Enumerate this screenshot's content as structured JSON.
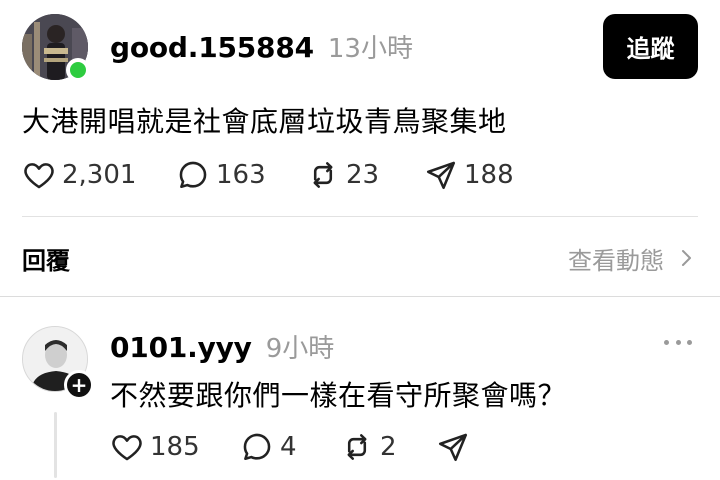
{
  "post": {
    "username": "good.155884",
    "time": "13小時",
    "follow_label": "追蹤",
    "text": "大港開唱就是社會底層垃圾青鳥聚集地",
    "likes": "2,301",
    "comments": "163",
    "reposts": "23",
    "shares": "188"
  },
  "replies_header": {
    "title": "回覆",
    "view_activity": "查看動態"
  },
  "reply": {
    "username": "0101.yyy",
    "time": "9小時",
    "text": "不然要跟你們一樣在看守所聚會嗎？",
    "likes": "185",
    "comments": "4",
    "reposts": "2",
    "follow_badge": "+"
  },
  "colors": {
    "online": "#2ecc40",
    "muted": "#9a9a9a",
    "button": "#000000"
  },
  "icons": [
    "heart-icon",
    "comment-icon",
    "repost-icon",
    "share-icon",
    "chevron-right-icon",
    "more-icon",
    "plus-icon"
  ]
}
